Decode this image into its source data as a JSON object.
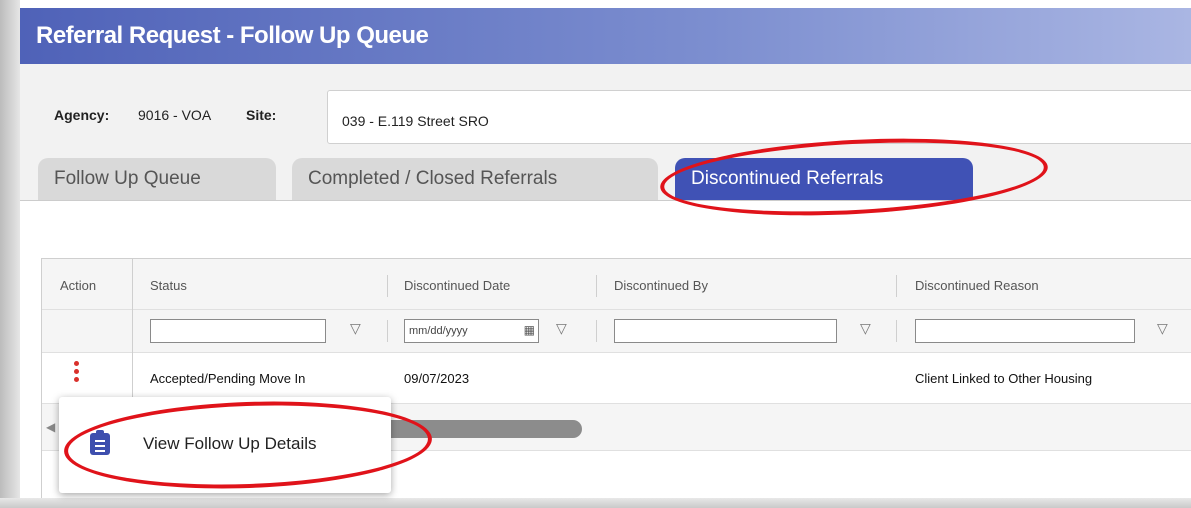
{
  "window": {
    "title": "Referral Request - Follow Up Queue"
  },
  "agency": {
    "label": "Agency:",
    "value": "9016 - VOA",
    "site_label": "Site:",
    "site_value": "039 - E.119 Street SRO"
  },
  "tabs": [
    {
      "label": "Follow Up Queue",
      "active": false
    },
    {
      "label": "Completed / Closed Referrals",
      "active": false
    },
    {
      "label": "Discontinued Referrals",
      "active": true
    }
  ],
  "grid": {
    "columns": [
      "Action",
      "Status",
      "Discontinued Date",
      "Discontinued By",
      "Discontinued Reason"
    ],
    "filters": {
      "date_placeholder": "mm/dd/yyyy"
    },
    "rows": [
      {
        "status": "Accepted/Pending Move In",
        "date": "09/07/2023",
        "by": "",
        "reason": "Client Linked to Other Housing"
      }
    ]
  },
  "popup": {
    "item_label": "View Follow Up Details",
    "icon": "clipboard-icon"
  },
  "colors": {
    "accent": "#4052b5",
    "annotation": "#e0131a",
    "kebab": "#d9302b"
  }
}
